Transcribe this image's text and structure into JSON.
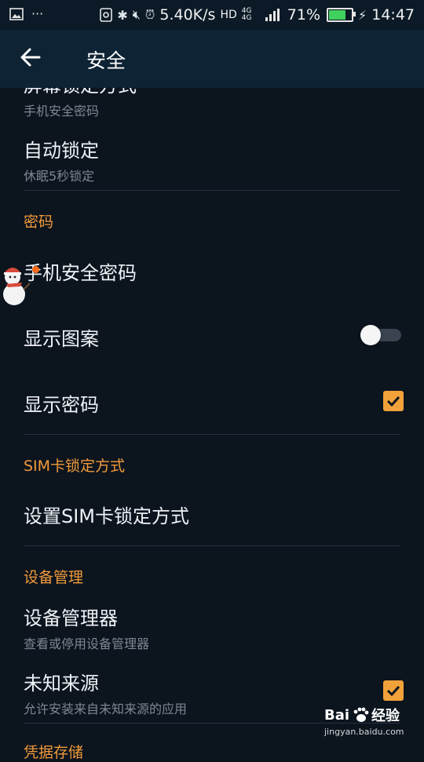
{
  "status_bar": {
    "speed": "5.40K/s",
    "network": "HD",
    "net_tags": "4G 4G",
    "battery": "71%",
    "time": "14:47",
    "colors": {
      "battery_fill": "#41d15d"
    }
  },
  "app_bar": {
    "title": "安全",
    "back_icon": "arrow-left-icon"
  },
  "screen_lock": {
    "title": "屏幕锁定方式",
    "subtitle": "手机安全密码"
  },
  "auto_lock": {
    "title": "自动锁定",
    "subtitle": "休眠5秒锁定"
  },
  "password_section": {
    "header": "密码",
    "phone_password": {
      "title": "手机安全密码"
    },
    "show_pattern": {
      "title": "显示图案",
      "enabled": false
    },
    "show_password": {
      "title": "显示密码",
      "checked": true
    }
  },
  "sim_section": {
    "header": "SIM卡锁定方式",
    "setup": {
      "title": "设置SIM卡锁定方式"
    }
  },
  "device_section": {
    "header": "设备管理",
    "device_admin": {
      "title": "设备管理器",
      "subtitle": "查看或停用设备管理器"
    },
    "unknown_sources": {
      "title": "未知来源",
      "subtitle": "允许安装来自未知来源的应用",
      "checked": true
    }
  },
  "credentials_section": {
    "header": "凭据存储"
  },
  "watermark": {
    "brand": "Bai",
    "brand2": "经验",
    "url": "jingyan.baidu.com"
  },
  "colors": {
    "accent": "#f19a3a",
    "background": "#0c141e",
    "app_bar": "#0e2334",
    "checkbox": "#f2a23a"
  }
}
